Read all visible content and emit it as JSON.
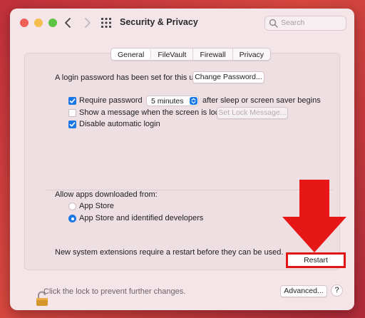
{
  "window": {
    "title": "Security & Privacy",
    "search_placeholder": "Search"
  },
  "tabs": [
    {
      "label": "General",
      "active": true
    },
    {
      "label": "FileVault",
      "active": false
    },
    {
      "label": "Firewall",
      "active": false
    },
    {
      "label": "Privacy",
      "active": false
    }
  ],
  "general": {
    "login_password_text": "A login password has been set for this user",
    "change_password_button": "Change Password...",
    "require_password_label": "Require password",
    "require_password_checked": true,
    "require_password_value": "5 minutes",
    "require_password_suffix": "after sleep or screen saver begins",
    "show_message_label": "Show a message when the screen is locked",
    "show_message_checked": false,
    "set_lock_message_button": "Set Lock Message...",
    "disable_auto_login_label": "Disable automatic login",
    "disable_auto_login_checked": true
  },
  "apps": {
    "heading": "Allow apps downloaded from:",
    "options": [
      {
        "label": "App Store",
        "selected": false
      },
      {
        "label": "App Store and identified developers",
        "selected": true
      }
    ]
  },
  "extensions": {
    "message": "New system extensions require a restart before they can be used.",
    "restart_button": "Restart"
  },
  "footer": {
    "lock_text": "Click the lock to prevent further changes.",
    "advanced_button": "Advanced...",
    "help_button": "?"
  },
  "colors": {
    "accent": "#1a78e6",
    "highlight": "#e01616"
  }
}
